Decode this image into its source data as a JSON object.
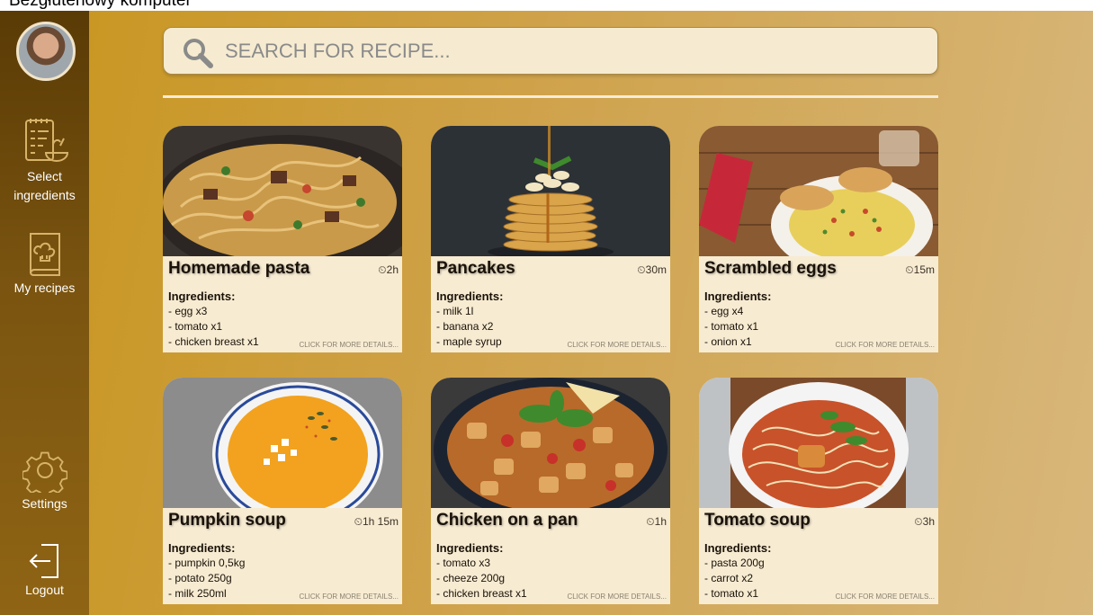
{
  "header_cut_text": "Bezgłutenowy komputer",
  "sidebar": {
    "items": [
      {
        "label": "Select ingredients",
        "icon": "ingredients-list-icon"
      },
      {
        "label": "My recipes",
        "icon": "recipe-book-icon"
      },
      {
        "label": "Settings",
        "icon": "gear-icon"
      },
      {
        "label": "Logout",
        "icon": "logout-icon"
      }
    ]
  },
  "search": {
    "placeholder": "SEARCH FOR RECIPE..."
  },
  "cards": [
    {
      "title": "Homemade pasta",
      "time": "2h",
      "ingredients_label": "Ingredients:",
      "ingredients": [
        "- egg x3",
        "- tomato x1",
        "- chicken breast x1"
      ],
      "more": "CLICK FOR MORE DETAILS..."
    },
    {
      "title": "Pancakes",
      "time": "30m",
      "ingredients_label": "Ingredients:",
      "ingredients": [
        "- milk 1l",
        "- banana x2",
        "- maple syrup"
      ],
      "more": "CLICK FOR MORE DETAILS..."
    },
    {
      "title": "Scrambled eggs",
      "time": "15m",
      "ingredients_label": "Ingredients:",
      "ingredients": [
        "- egg x4",
        "- tomato x1",
        "- onion x1"
      ],
      "more": "CLICK FOR MORE DETAILS..."
    },
    {
      "title": "Pumpkin soup",
      "time": "1h 15m",
      "ingredients_label": "Ingredients:",
      "ingredients": [
        "- pumpkin 0,5kg",
        "- potato 250g",
        "- milk 250ml"
      ],
      "more": "CLICK FOR MORE DETAILS..."
    },
    {
      "title": "Chicken on a pan",
      "time": "1h",
      "ingredients_label": "Ingredients:",
      "ingredients": [
        "- tomato x3",
        "- cheeze 200g",
        "- chicken breast x1"
      ],
      "more": "CLICK FOR MORE DETAILS..."
    },
    {
      "title": "Tomato soup",
      "time": "3h",
      "ingredients_label": "Ingredients:",
      "ingredients": [
        "- pasta 200g",
        "- carrot x2",
        "- tomato x1"
      ],
      "more": "CLICK FOR MORE DETAILS..."
    }
  ],
  "colors": {
    "sidebar": "#6b4708",
    "card_bg": "#f7ebd2",
    "search_bg": "#f6ebd0",
    "accent": "#c8951c"
  }
}
